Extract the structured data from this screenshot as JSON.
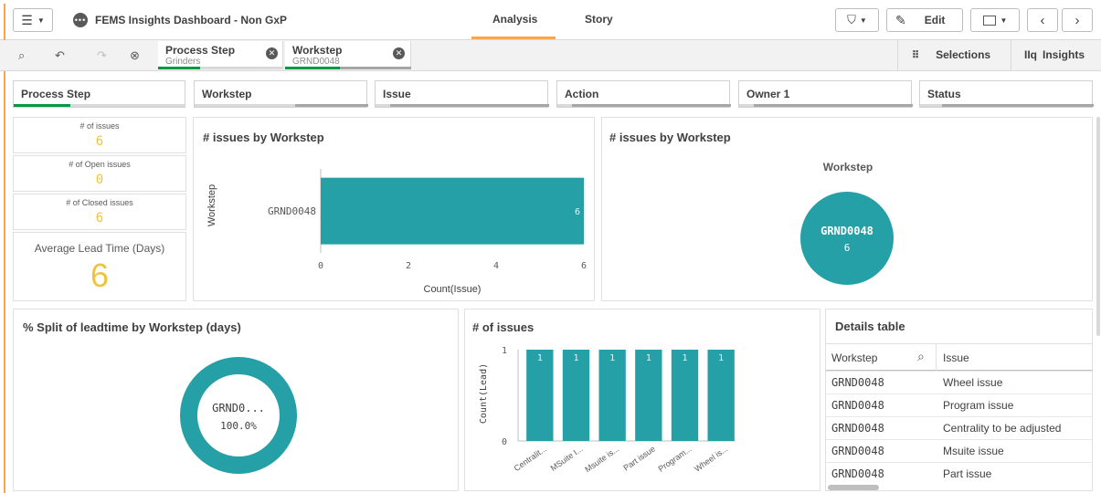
{
  "app": {
    "title": "FEMS Insights Dashboard - Non GxP",
    "tabs": [
      "Analysis",
      "Story"
    ],
    "edit_label": "Edit"
  },
  "selections_bar": {
    "chips": [
      {
        "label": "Process Step",
        "value": "Grinders"
      },
      {
        "label": "Workstep",
        "value": "GRND0048"
      }
    ],
    "selections_label": "Selections",
    "insights_label": "Insights"
  },
  "filters": [
    "Process Step",
    "Workstep",
    "Issue",
    "Action",
    "Owner 1",
    "Status"
  ],
  "kpis": {
    "issues": {
      "label": "# of issues",
      "value": "6"
    },
    "open": {
      "label": "# of Open issues",
      "value": "0"
    },
    "closed": {
      "label": "# of Closed issues",
      "value": "6"
    },
    "lead": {
      "label": "Average Lead Time (Days)",
      "value": "6"
    }
  },
  "panels": {
    "bar_title": "# issues by Workstep",
    "bubble_title": "# issues by Workstep",
    "bubble_subtitle": "Workstep",
    "donut_title": "% Split of leadtime by Workstep (days)",
    "col_title": "# of issues",
    "table_title": "Details table"
  },
  "colors": {
    "teal": "#26a0a7",
    "kpi_yellow": "#f0c43a",
    "green": "#009845",
    "accent_orange": "#f8a54c"
  },
  "chart_data": [
    {
      "type": "bar",
      "orientation": "horizontal",
      "title": "# issues by Workstep",
      "categories": [
        "GRND0048"
      ],
      "values": [
        6
      ],
      "data_labels": [
        "6"
      ],
      "xlabel": "Count(Issue)",
      "ylabel": "Workstep",
      "xlim": [
        0,
        6
      ],
      "xticks": [
        "0",
        "2",
        "4",
        "6"
      ]
    },
    {
      "type": "scatter",
      "title": "# issues by Workstep",
      "subtitle": "Workstep",
      "categories": [
        "GRND0048"
      ],
      "values": [
        6
      ],
      "data_labels": [
        "6"
      ]
    },
    {
      "type": "pie",
      "title": "% Split of leadtime by Workstep (days)",
      "categories": [
        "GRND0..."
      ],
      "values": [
        100.0
      ],
      "data_labels": [
        "100.0%"
      ]
    },
    {
      "type": "bar",
      "title": "# of issues",
      "categories": [
        "Centralit...",
        "MSuite I...",
        "Msuite is...",
        "Part issue",
        "Program...",
        "Wheel is..."
      ],
      "values": [
        1,
        1,
        1,
        1,
        1,
        1
      ],
      "data_labels": [
        "1",
        "1",
        "1",
        "1",
        "1",
        "1"
      ],
      "ylabel": "Count(Lead)",
      "ylim": [
        0,
        1
      ],
      "yticks": [
        "0",
        "1"
      ]
    }
  ],
  "details_table": {
    "columns": [
      "Workstep",
      "Issue"
    ],
    "rows": [
      [
        "GRND0048",
        "Wheel issue"
      ],
      [
        "GRND0048",
        "Program issue"
      ],
      [
        "GRND0048",
        "Centrality to be adjusted"
      ],
      [
        "GRND0048",
        "Msuite issue"
      ],
      [
        "GRND0048",
        "Part issue"
      ]
    ]
  }
}
